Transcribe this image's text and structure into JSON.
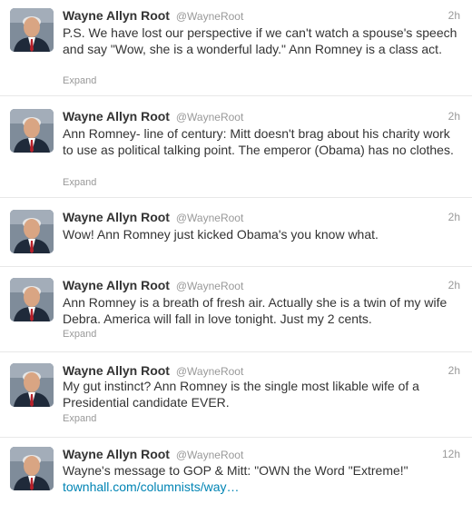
{
  "tweets": [
    {
      "author": "Wayne Allyn Root",
      "handle": "@WayneRoot",
      "time": "2h",
      "text": "P.S. We have lost our perspective if we can't watch a spouse's speech and say \"Wow, she is a wonderful lady.\" Ann Romney is a class act.",
      "expand": "Expand"
    },
    {
      "author": "Wayne Allyn Root",
      "handle": "@WayneRoot",
      "time": "2h",
      "text": "Ann Romney- line of century: Mitt doesn't brag about his charity work to use as political talking point. The emperor (Obama) has no clothes.",
      "expand": "Expand"
    },
    {
      "author": "Wayne Allyn Root",
      "handle": "@WayneRoot",
      "time": "2h",
      "text": "Wow! Ann Romney just kicked Obama's you know what.",
      "expand": ""
    },
    {
      "author": "Wayne Allyn Root",
      "handle": "@WayneRoot",
      "time": "2h",
      "text": "Ann Romney is a breath of fresh air. Actually she is a twin of my wife Debra. America will fall in love tonight. Just my 2 cents.",
      "expand": "Expand"
    },
    {
      "author": "Wayne Allyn Root",
      "handle": "@WayneRoot",
      "time": "2h",
      "text": "My gut instinct? Ann Romney is the single most likable wife of a Presidential candidate EVER.",
      "expand": "Expand"
    },
    {
      "author": "Wayne Allyn Root",
      "handle": "@WayneRoot",
      "time": "12h",
      "text": "Wayne's message to GOP & Mitt: \"OWN the Word \"Extreme!\"",
      "link": "townhall.com/columnists/way…",
      "expand": ""
    }
  ]
}
